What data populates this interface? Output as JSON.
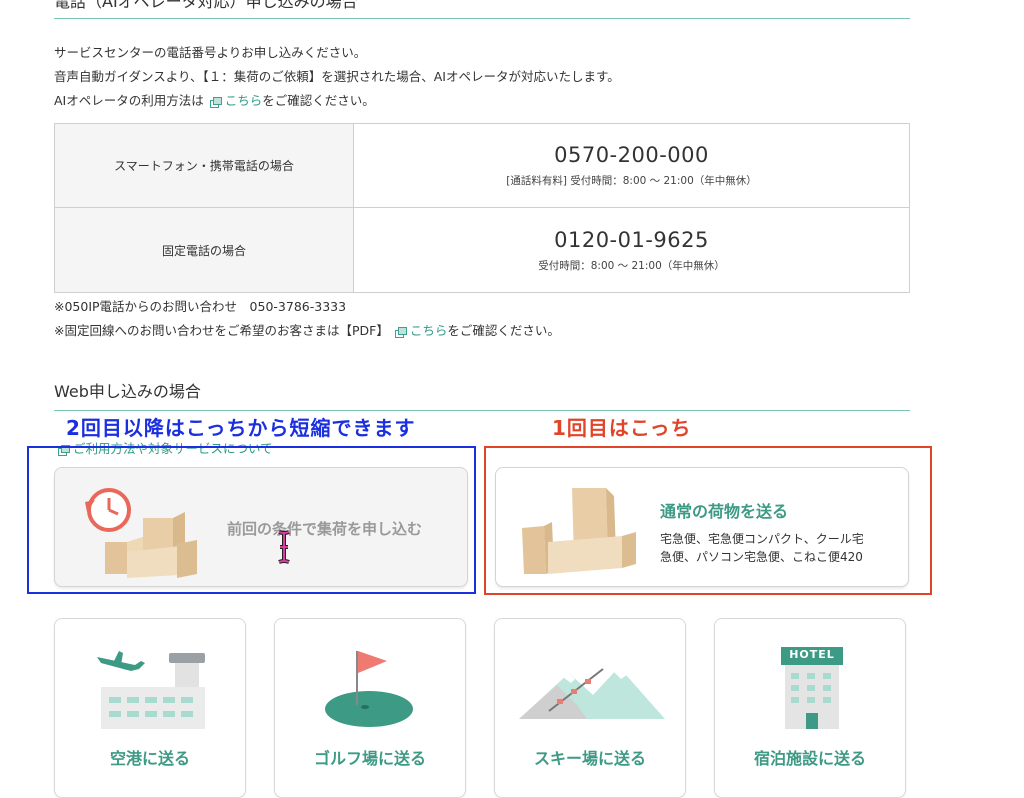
{
  "phone_section": {
    "title": "電話（AIオペレータ対応）申し込みの場合",
    "intro_lines": [
      "サービスセンターの電話番号よりお申し込みください。",
      "音声自動ガイダンスより、【１：集荷のご依頼】を選択された場合、AIオペレータが対応いたします。"
    ],
    "ai_usage_prefix": "AIオペレータの利用方法は",
    "ai_usage_link": "こちら",
    "ai_usage_suffix": "をご確認ください。",
    "table": [
      {
        "label": "スマートフォン・携帯電話の場合",
        "number": "0570-200-000",
        "hours": "[通話料有料] 受付時間：8:00 ～ 21:00（年中無休）"
      },
      {
        "label": "固定電話の場合",
        "number": "0120-01-9625",
        "hours": "受付時間：8:00 ～ 21:00（年中無休）"
      }
    ],
    "note_ip": "※050IP電話からのお問い合わせ　050-3786-3333",
    "note_fixed_prefix": "※固定回線へのお問い合わせをご希望のお客さまは【PDF】",
    "note_fixed_link": "こちら",
    "note_fixed_suffix": "をご確認ください。"
  },
  "web_section": {
    "title": "Web申し込みの場合",
    "usage_link": "ご利用方法や対象サービスについて",
    "repeat_button_label": "前回の条件で集荷を申し込む",
    "normal_button": {
      "title": "通常の荷物を送る",
      "desc_line1": "宅急便、宅急便コンパクト、クール宅",
      "desc_line2": "急便、パソコン宅急便、こねこ便420"
    },
    "destinations": [
      {
        "label": "空港に送る",
        "icon": "airport-icon"
      },
      {
        "label": "ゴルフ場に送る",
        "icon": "golf-icon"
      },
      {
        "label": "スキー場に送る",
        "icon": "ski-icon"
      },
      {
        "label": "宿泊施設に送る",
        "icon": "hotel-icon"
      }
    ],
    "hotel_sign": "HOTEL"
  },
  "annotations": {
    "blue_text": "2回目以降はこっちから短縮できます",
    "red_text": "1回目はこっち",
    "blue_color": "#1a2fe0",
    "red_color": "#e0452a"
  },
  "colors": {
    "accent": "#3d9a85",
    "rule": "#7cc6b6",
    "box_tan": "#e8cda6"
  }
}
